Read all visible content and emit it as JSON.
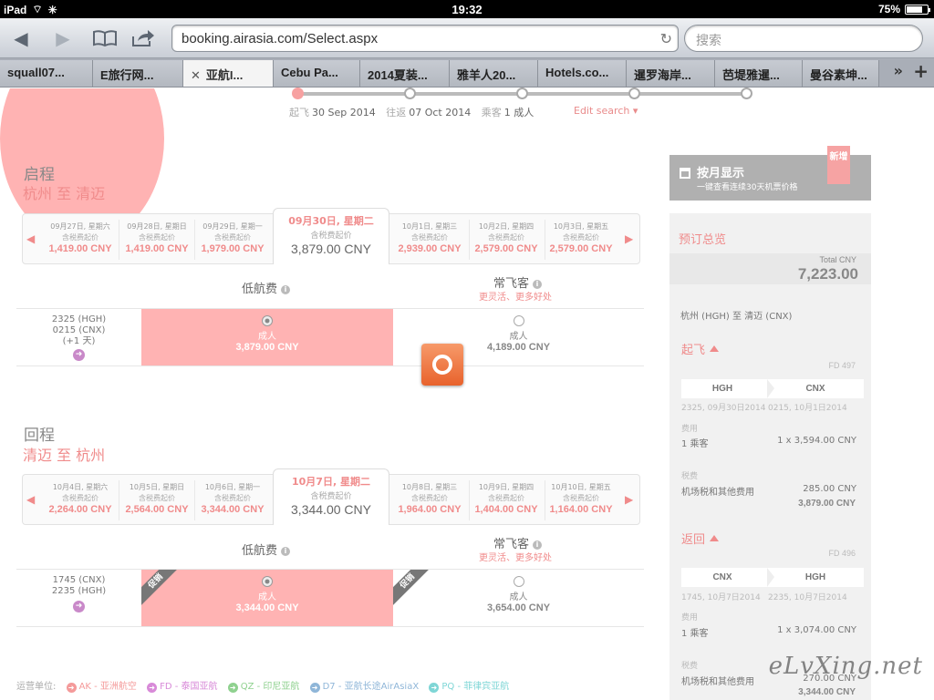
{
  "status": {
    "device": "iPad",
    "time": "19:32",
    "battery": "75%",
    "battery_level": 0.75
  },
  "toolbar": {
    "url": "booking.airasia.com/Select.aspx",
    "search_placeholder": "搜索"
  },
  "tabs": [
    "squall07...",
    "E旅行网...",
    "亚航I...",
    "Cebu Pa...",
    "2014夏装...",
    "雅羊人20...",
    "Hotels.co...",
    "暹罗海岸...",
    "芭堤雅暹...",
    "曼谷素坤..."
  ],
  "active_tab": 2,
  "progress_step": 0,
  "search_info": {
    "depart_label": "起飞",
    "depart": "30 Sep 2014",
    "return_label": "往返",
    "return": "07 Oct 2014",
    "pax_label": "乘客",
    "pax": "1 成人",
    "edit": "Edit search"
  },
  "outbound": {
    "title": "启程",
    "route": "杭州 至 清迈",
    "dates_before": [
      {
        "date": "09月27日, 星期六",
        "sub": "含税费起价",
        "price": "1,419.00 CNY"
      },
      {
        "date": "09月28日, 星期日",
        "sub": "含税费起价",
        "price": "1,419.00 CNY"
      },
      {
        "date": "09月29日, 星期一",
        "sub": "含税费起价",
        "price": "1,979.00 CNY"
      }
    ],
    "selected": {
      "date": "09月30日, 星期二",
      "sub": "含税费起价",
      "price": "3,879.00 CNY"
    },
    "dates_after": [
      {
        "date": "10月1日, 星期三",
        "sub": "含税费起价",
        "price": "2,939.00 CNY"
      },
      {
        "date": "10月2日, 星期四",
        "sub": "含税费起价",
        "price": "2,579.00 CNY"
      },
      {
        "date": "10月3日, 星期五",
        "sub": "含税费起价",
        "price": "2,579.00 CNY"
      }
    ],
    "flight": {
      "dep": "2325  (HGH)",
      "arr": "0215  (CNX)",
      "note": "(+1 天)"
    },
    "low": {
      "label": "成人",
      "price": "3,879.00 CNY"
    },
    "flex": {
      "label": "成人",
      "price": "4,189.00 CNY"
    }
  },
  "inbound": {
    "title": "回程",
    "route": "清迈 至 杭州",
    "dates_before": [
      {
        "date": "10月4日, 星期六",
        "sub": "含税费起价",
        "price": "2,264.00 CNY"
      },
      {
        "date": "10月5日, 星期日",
        "sub": "含税费起价",
        "price": "2,564.00 CNY"
      },
      {
        "date": "10月6日, 星期一",
        "sub": "含税费起价",
        "price": "3,344.00 CNY"
      }
    ],
    "selected": {
      "date": "10月7日, 星期二",
      "sub": "含税费起价",
      "price": "3,344.00 CNY"
    },
    "dates_after": [
      {
        "date": "10月8日, 星期三",
        "sub": "含税费起价",
        "price": "1,964.00 CNY"
      },
      {
        "date": "10月9日, 星期四",
        "sub": "含税费起价",
        "price": "1,404.00 CNY"
      },
      {
        "date": "10月10日, 星期五",
        "sub": "含税费起价",
        "price": "1,164.00 CNY"
      }
    ],
    "flight": {
      "dep": "1745  (CNX)",
      "arr": "2235  (HGH)"
    },
    "low": {
      "label": "成人",
      "price": "3,344.00 CNY",
      "promo": "促销"
    },
    "flex": {
      "label": "成人",
      "price": "3,654.00 CNY",
      "promo": "促销"
    }
  },
  "fare_header": {
    "low": "低航费",
    "flex": "常飞客",
    "flex_sub": "更灵活、更多好处",
    "info": "i"
  },
  "carriers": {
    "label": "运营单位:",
    "items": [
      {
        "text": "AK - 亚洲航空",
        "color": "#f49a9a"
      },
      {
        "text": "FD - 泰国亚航",
        "color": "#d88ad8"
      },
      {
        "text": "QZ - 印尼亚航",
        "color": "#8fd18f"
      },
      {
        "text": "D7 - 亚航长途AirAsiaX",
        "color": "#8fb6d8"
      },
      {
        "text": "PQ - 菲律宾亚航",
        "color": "#7fd6d6"
      }
    ]
  },
  "sidebar": {
    "monthly_title": "按月显示",
    "monthly_sub": "一键查看连续30天机票价格",
    "new_badge": "新增",
    "summary_title": "预订总览",
    "total_label": "Total CNY",
    "total": "7,223.00",
    "route": "杭州 (HGH) 至 清迈 (CNX)",
    "depart": {
      "title": "起飞",
      "flight": "FD 497",
      "from": "HGH",
      "to": "CNX",
      "from_time": "2325, 09月30日2014",
      "to_time": "0215, 10月1日2014",
      "fee_label": "费用",
      "pax": "1 乘客",
      "pax_fare": "1 x 3,594.00 CNY",
      "tax_label": "税费",
      "tax_name": "机场税和其他费用",
      "tax": "285.00 CNY",
      "subtotal": "3,879.00 CNY"
    },
    "return": {
      "title": "返回",
      "flight": "FD 496",
      "from": "CNX",
      "to": "HGH",
      "from_time": "1745, 10月7日2014",
      "to_time": "2235, 10月7日2014",
      "fee_label": "费用",
      "pax": "1 乘客",
      "pax_fare": "1 x 3,074.00 CNY",
      "tax_label": "税费",
      "tax_name": "机场税和其他费用",
      "tax": "270.00 CNY",
      "subtotal": "3,344.00 CNY"
    }
  },
  "watermark": "eLvXing.net"
}
